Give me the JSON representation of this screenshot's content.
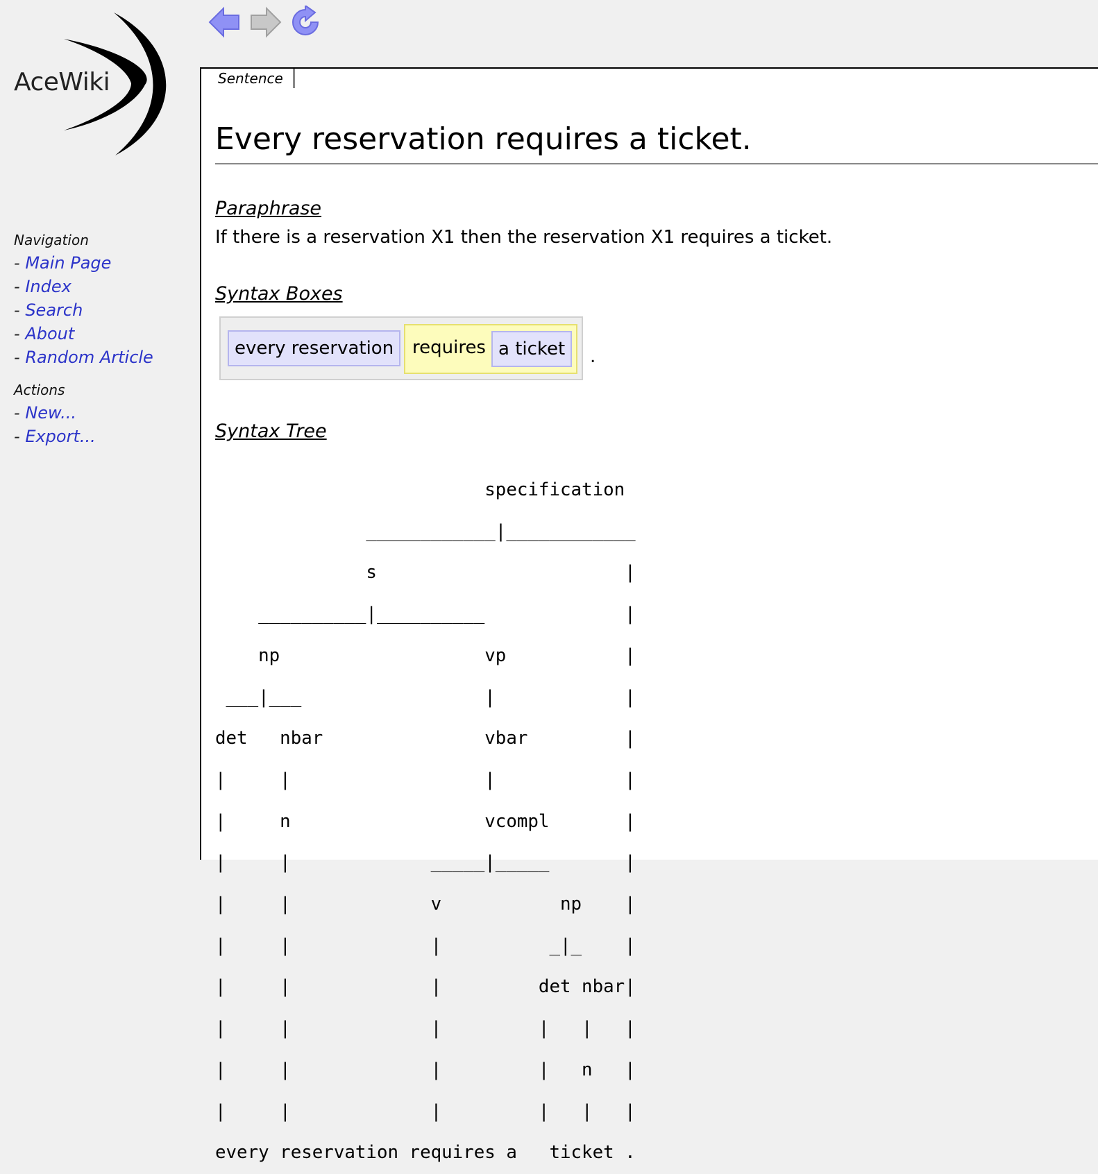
{
  "app": {
    "logo_text": "AceWiki"
  },
  "toolbar": {
    "back_icon": "back-arrow-icon",
    "forward_icon": "forward-arrow-icon",
    "refresh_icon": "refresh-icon",
    "colors": {
      "active": "#7a7cf0",
      "inactive": "#bdbdbd"
    }
  },
  "sidebar": {
    "navigation": {
      "heading": "Navigation",
      "items": [
        {
          "label": "Main Page"
        },
        {
          "label": "Index"
        },
        {
          "label": "Search"
        },
        {
          "label": "About"
        },
        {
          "label": "Random Article"
        }
      ]
    },
    "actions": {
      "heading": "Actions",
      "items": [
        {
          "label": "New..."
        },
        {
          "label": "Export..."
        }
      ]
    },
    "bullet": "-"
  },
  "main": {
    "tab_label": "Sentence",
    "title": "Every reservation requires a ticket.",
    "paraphrase": {
      "heading": "Paraphrase",
      "text": "If there is a reservation X1 then the reservation X1 requires a ticket."
    },
    "syntax_boxes": {
      "heading": "Syntax Boxes",
      "np1": "every reservation",
      "verb": "requires",
      "np2": "a ticket",
      "period": ".",
      "colors": {
        "np": "#e2e2fb",
        "vp": "#fdfcbc",
        "outer": "#eeeeee"
      }
    },
    "syntax_tree": {
      "heading": "Syntax Tree",
      "lines": [
        "                         specification",
        "              ____________|____________",
        "              s                       |",
        "    __________|__________             |",
        "    np                   vp           |",
        " ___|___                 |            |",
        "det   nbar               vbar         |",
        "|     |                  |            |",
        "|     n                  vcompl       |",
        "|     |             _____|_____       |",
        "|     |             v           np    |",
        "|     |             |          _|_    |",
        "|     |             |         det nbar|",
        "|     |             |         |   |   |",
        "|     |             |         |   n   |",
        "|     |             |         |   |   |",
        "every reservation requires a   ticket ."
      ]
    }
  }
}
